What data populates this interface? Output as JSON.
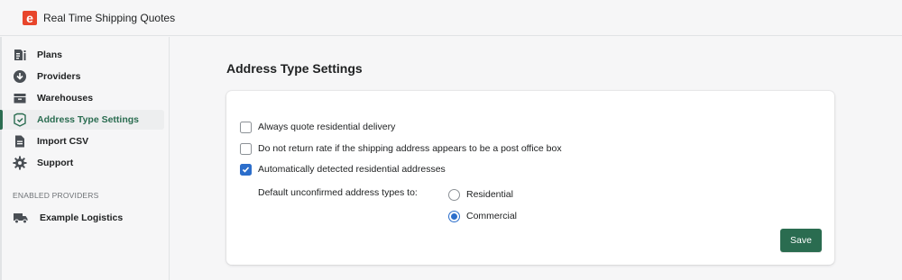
{
  "app": {
    "title": "Real Time Shipping Quotes",
    "logo_letter": "e",
    "brand_color": "#e8452b"
  },
  "sidebar": {
    "items": [
      {
        "label": "Plans",
        "icon": "document-icon"
      },
      {
        "label": "Providers",
        "icon": "arrow-down-circle-icon"
      },
      {
        "label": "Warehouses",
        "icon": "warehouse-icon"
      },
      {
        "label": "Address Type Settings",
        "icon": "shield-check-icon",
        "active": true
      },
      {
        "label": "Import CSV",
        "icon": "file-icon"
      },
      {
        "label": "Support",
        "icon": "gear-icon"
      }
    ],
    "enabled_heading": "ENABLED PROVIDERS",
    "providers": [
      {
        "label": "Example Logistics",
        "icon": "truck-icon"
      }
    ],
    "active_color": "#2a6c50"
  },
  "main": {
    "page_title": "Address Type Settings",
    "options": [
      {
        "label": "Always quote residential delivery",
        "checked": false
      },
      {
        "label": "Do not return rate if the shipping address appears to be a post office box",
        "checked": false
      },
      {
        "label": "Automatically detected residential addresses",
        "checked": true
      }
    ],
    "default_label": "Default unconfirmed address types to:",
    "radio_options": [
      {
        "label": "Residential",
        "selected": false
      },
      {
        "label": "Commercial",
        "selected": true
      }
    ],
    "save_label": "Save",
    "accent_color": "#2c6ecb"
  }
}
